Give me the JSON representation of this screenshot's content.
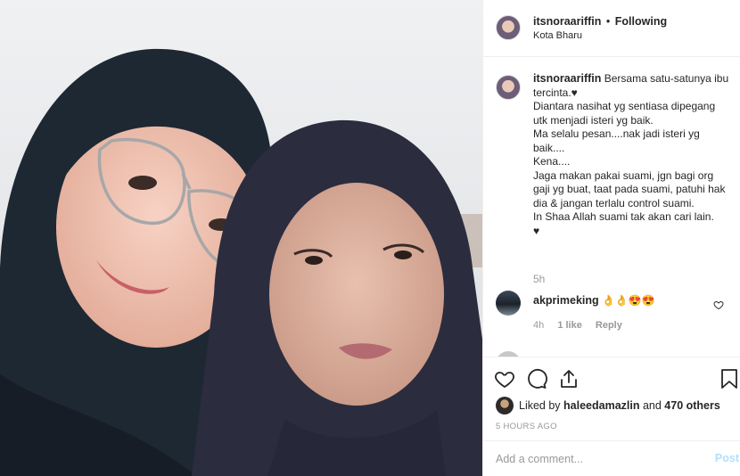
{
  "header": {
    "username": "itsnoraariffin",
    "separator": "•",
    "follow_status": "Following",
    "location": "Kota Bharu"
  },
  "caption": {
    "username": "itsnoraariffin",
    "lines": [
      " Bersama satu-satunya ibu tercinta.♥",
      "Diantara nasihat yg sentiasa dipegang utk menjadi isteri yg baik.",
      "Ma selalu pesan....nak jadi isteri yg baik....",
      "Kena....",
      "Jaga makan pakai suami, jgn bagi org gaji yg buat, taat pada suami, patuhi hak dia & jangan terlalu control suami.",
      "In Shaa Allah suami tak akan cari lain.",
      "♥"
    ],
    "time": "5h"
  },
  "comment": {
    "username": "akprimeking",
    "text": " 👌👌😍😍",
    "time": "4h",
    "likes": "1 like",
    "reply": "Reply"
  },
  "actions": {
    "icons": [
      "heart-icon",
      "comment-icon",
      "share-icon",
      "bookmark-icon"
    ],
    "liked_by_prefix": "Liked by ",
    "liked_by_user": "haleedamazlin",
    "liked_by_suffix": " and ",
    "others": "470 others",
    "time_ago": "5 HOURS AGO"
  },
  "add_comment": {
    "placeholder": "Add a comment...",
    "post_label": "Post"
  },
  "colors": {
    "muted": "#999999",
    "post_disabled": "#b2dffc",
    "text": "#262626",
    "border": "#efefef"
  }
}
